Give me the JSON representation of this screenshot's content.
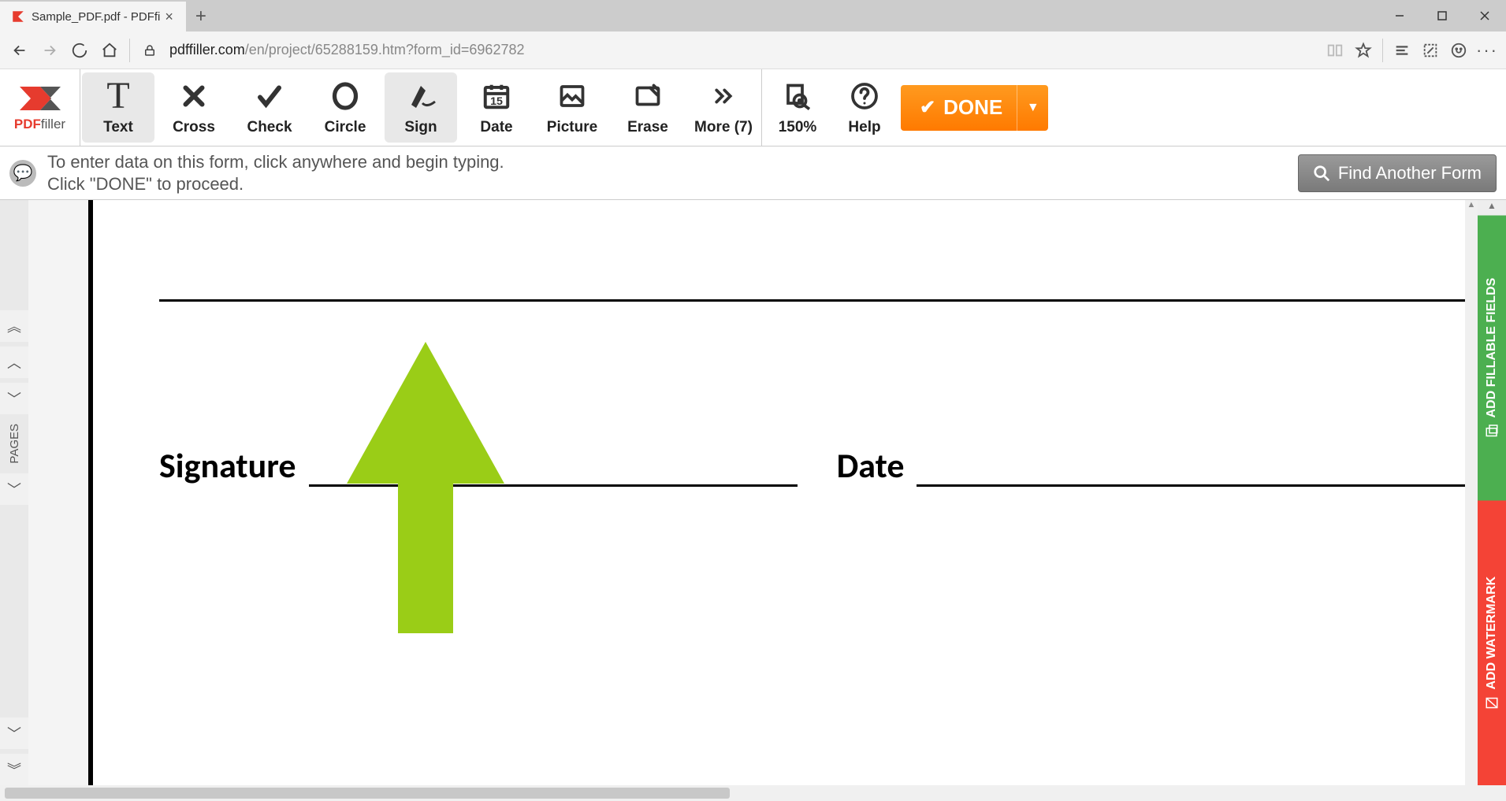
{
  "browser": {
    "tab_title": "Sample_PDF.pdf - PDFfi",
    "url_host": "pdffiller.com",
    "url_path": "/en/project/65288159.htm?form_id=6962782"
  },
  "logo": {
    "brand_left": "PDF",
    "brand_right": "filler"
  },
  "toolbar": {
    "text": "Text",
    "cross": "Cross",
    "check": "Check",
    "circle": "Circle",
    "sign": "Sign",
    "date": "Date",
    "picture": "Picture",
    "erase": "Erase",
    "more": "More (7)",
    "zoom": "150%",
    "help": "Help",
    "done": "DONE"
  },
  "hint": {
    "line1": "To enter data on this form, click anywhere and begin typing.",
    "line2": "Click \"DONE\" to proceed."
  },
  "find_form": "Find Another Form",
  "document": {
    "signature_label": "Signature",
    "date_label": "Date"
  },
  "left_rail": {
    "pages": "PAGES"
  },
  "right_rail": {
    "fillable": "ADD FILLABLE FIELDS",
    "watermark": "ADD WATERMARK"
  }
}
